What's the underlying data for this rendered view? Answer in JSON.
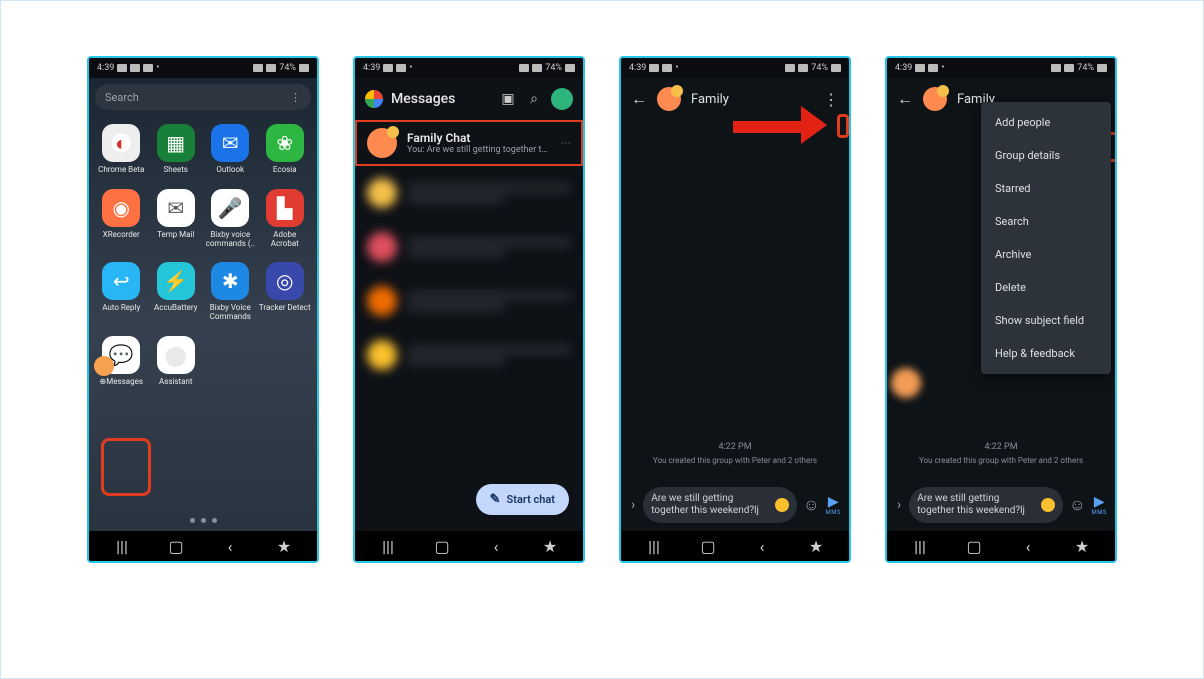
{
  "status": {
    "time": "4:39",
    "battery": "74%"
  },
  "phone1": {
    "search_placeholder": "Search",
    "apps": [
      {
        "label": "Chrome Beta",
        "cls": "chrome",
        "icon": "◐"
      },
      {
        "label": "Sheets",
        "cls": "sheets",
        "icon": "▦"
      },
      {
        "label": "Outlook",
        "cls": "outlook",
        "icon": "✉"
      },
      {
        "label": "Ecosia",
        "cls": "ecosia",
        "icon": "❀"
      },
      {
        "label": "XRecorder",
        "cls": "xrec",
        "icon": "◉"
      },
      {
        "label": "Temp Mail",
        "cls": "tempmail",
        "icon": "✉"
      },
      {
        "label": "Bixby voice commands (..",
        "cls": "bixby1",
        "icon": "🎤"
      },
      {
        "label": "Adobe Acrobat",
        "cls": "adobe",
        "icon": "▙"
      },
      {
        "label": "Auto Reply",
        "cls": "autoreply",
        "icon": "↩"
      },
      {
        "label": "AccuBattery",
        "cls": "accu",
        "icon": "⚡"
      },
      {
        "label": "Bixby Voice Commands",
        "cls": "bixby2",
        "icon": "✱"
      },
      {
        "label": "Tracker Detect",
        "cls": "tracker",
        "icon": "◎"
      },
      {
        "label": "⊕Messages",
        "cls": "messages",
        "icon": "💬"
      },
      {
        "label": "Assistant",
        "cls": "assistant",
        "icon": "⬤"
      }
    ]
  },
  "phone2": {
    "app_title": "Messages",
    "fab_label": "Start chat",
    "family": {
      "name": "Family Chat",
      "preview": "You: Are we still getting together thi…"
    }
  },
  "conversation": {
    "title_full": "Family Chat",
    "title_partial": "Family",
    "time": "4:22 PM",
    "system": "You created this group with Peter and 2 others",
    "draft": "Are we still getting together this weekend?lj",
    "send_label": "MMS"
  },
  "menu": {
    "items": [
      "Add people",
      "Group details",
      "Starred",
      "Search",
      "Archive",
      "Delete",
      "Show subject field",
      "Help & feedback"
    ]
  },
  "nav": {
    "recents": "|||",
    "home": "▢",
    "back": "‹",
    "accessibility": "★"
  }
}
